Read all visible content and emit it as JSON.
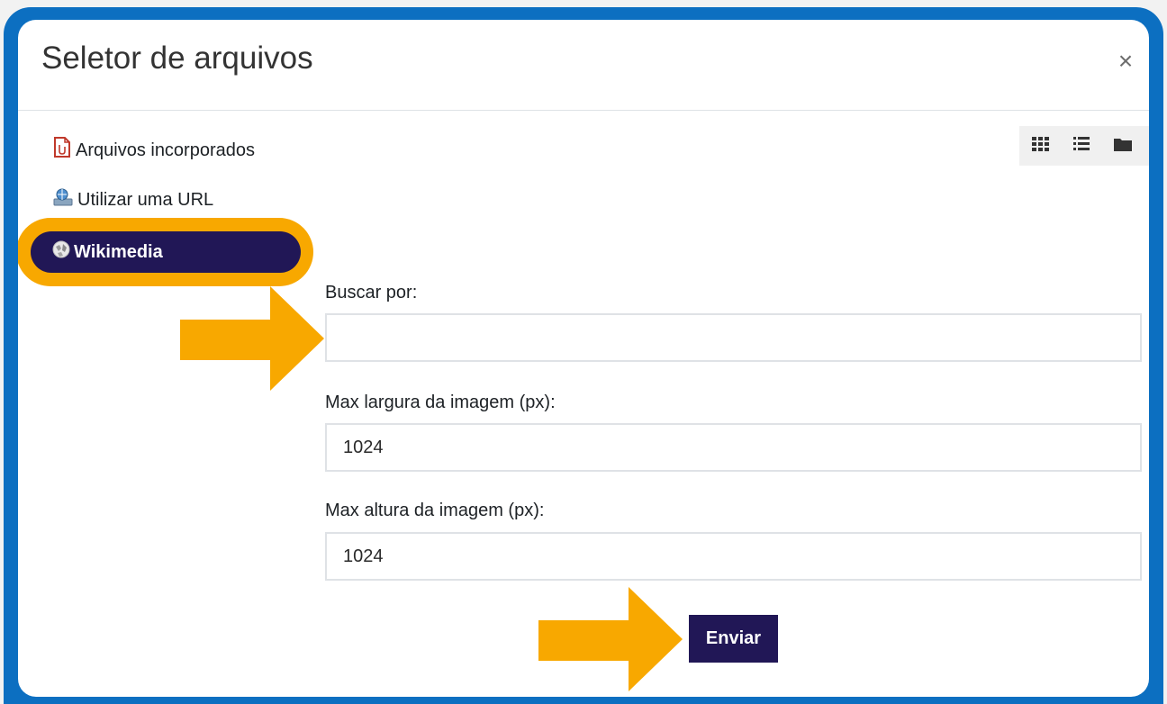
{
  "dialog": {
    "title": "Seletor de arquivos",
    "close_label": "×"
  },
  "repositories": [
    {
      "label": "Arquivos incorporados",
      "icon": "embedded-files-icon"
    },
    {
      "label": "Utilizar uma URL",
      "icon": "url-download-icon"
    },
    {
      "label": "Wikimedia",
      "icon": "wikimedia-globe-icon",
      "active": true
    }
  ],
  "view_toolbar": [
    {
      "name": "icon-view",
      "icon": "grid-icon"
    },
    {
      "name": "list-view",
      "icon": "list-icon"
    },
    {
      "name": "tree-view",
      "icon": "folder-icon"
    }
  ],
  "form": {
    "search_label": "Buscar por:",
    "search_value": "",
    "width_label": "Max largura da imagem (px):",
    "width_value": "1024",
    "height_label": "Max altura da imagem (px):",
    "height_value": "1024",
    "submit_label": "Enviar"
  },
  "colors": {
    "frame": "#0c6fc1",
    "highlight": "#f8a800",
    "accent": "#211756"
  }
}
